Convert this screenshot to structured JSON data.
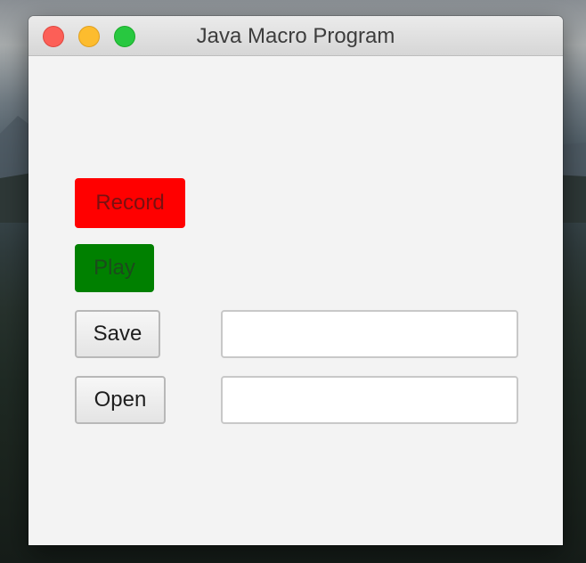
{
  "window": {
    "title": "Java Macro Program"
  },
  "titlebar": {
    "buttons": [
      {
        "name": "close",
        "color": "#fc5f57"
      },
      {
        "name": "minimize",
        "color": "#fdbc2e"
      },
      {
        "name": "maximize",
        "color": "#28c840"
      }
    ]
  },
  "controls": {
    "record_label": "Record",
    "record_color": "#ff0000",
    "play_label": "Play",
    "play_color": "#008000",
    "save_label": "Save",
    "open_label": "Open",
    "save_field_value": "",
    "open_field_value": ""
  }
}
